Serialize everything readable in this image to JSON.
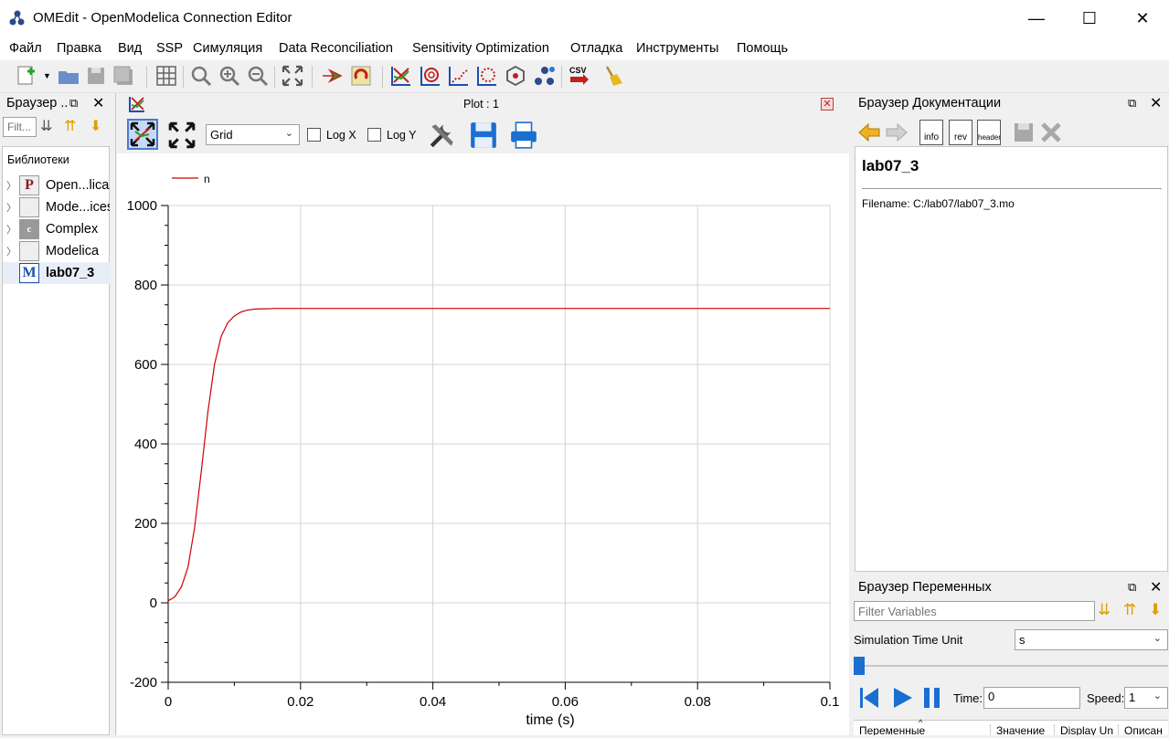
{
  "window": {
    "title": "OMEdit - OpenModelica Connection Editor"
  },
  "menu": [
    "Файл",
    "Правка",
    "Вид",
    "SSP",
    "Симуляция",
    "Data Reconciliation",
    "Sensitivity Optimization",
    "Отладка",
    "Инструменты",
    "Помощь"
  ],
  "library_browser": {
    "title": "Браузер ..",
    "filter_placeholder": "Filt...",
    "section_label": "Библиотеки",
    "items": [
      {
        "icon": "P",
        "label": "Open...lica",
        "expandable": true
      },
      {
        "icon": "",
        "label": "Mode...ices",
        "expandable": true
      },
      {
        "icon": "c",
        "label": "Complex",
        "expandable": true
      },
      {
        "icon": "",
        "label": "Modelica",
        "expandable": true
      },
      {
        "icon": "M",
        "label": "lab07_3",
        "expandable": false
      }
    ]
  },
  "plot": {
    "tab_title": "Plot : 1",
    "grid_option": "Grid",
    "log_x_label": "Log X",
    "log_y_label": "Log Y",
    "log_x_checked": false,
    "log_y_checked": false
  },
  "doc_browser": {
    "title": "Браузер Документации",
    "heading": "lab07_3",
    "filename_text": "Filename: C:/lab07/lab07_3.mo",
    "btn_info": "info",
    "btn_rev": "rev",
    "btn_header": "header"
  },
  "var_browser": {
    "title": "Браузер Переменных",
    "filter_placeholder": "Filter Variables",
    "sim_time_unit_label": "Simulation Time Unit",
    "sim_time_unit_value": "s",
    "time_label": "Time:",
    "time_value": "0",
    "speed_label": "Speed:",
    "speed_value": "1",
    "columns": [
      "Переменные",
      "Значение",
      "Display Un",
      "Описан"
    ]
  },
  "colors": {
    "series": "#cc0000",
    "accent": "#1a5fb4"
  },
  "chart_data": {
    "type": "line",
    "xlabel": "time (s)",
    "ylabel": "",
    "xlim": [
      0,
      0.1
    ],
    "ylim": [
      -200,
      1000
    ],
    "x_ticks": [
      "0",
      "0.02",
      "0.04",
      "0.06",
      "0.08",
      "0.1"
    ],
    "y_ticks": [
      "-200",
      "0",
      "200",
      "400",
      "600",
      "800",
      "1000"
    ],
    "grid": true,
    "legend": "top-left",
    "series": [
      {
        "name": "n",
        "color": "#cc0000",
        "x": [
          0,
          0.001,
          0.002,
          0.003,
          0.004,
          0.005,
          0.006,
          0.007,
          0.008,
          0.009,
          0.01,
          0.011,
          0.012,
          0.013,
          0.014,
          0.015,
          0.016,
          0.018,
          0.02,
          0.03,
          0.04,
          0.05,
          0.06,
          0.07,
          0.08,
          0.09,
          0.1
        ],
        "y": [
          5,
          15,
          40,
          90,
          190,
          330,
          480,
          600,
          670,
          705,
          722,
          732,
          737,
          739,
          740,
          740,
          741,
          741,
          741,
          741,
          741,
          741,
          741,
          741,
          741,
          741,
          741
        ]
      }
    ]
  }
}
